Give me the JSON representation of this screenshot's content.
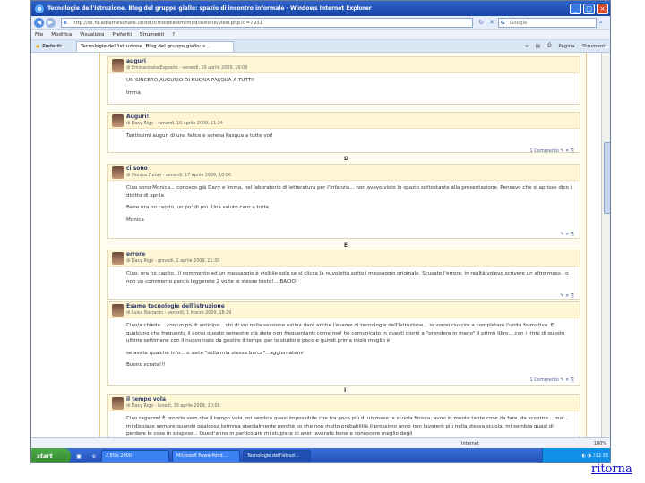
{
  "window": {
    "title": "Tecnologie dell'istruzione. Blog del gruppo giallo: spazio di incontro informale - Windows Internet Explorer",
    "address": "http://ss.f9.ad/ameschare.unisd.it/moodlestm/mod/lezione/view.php?d=7931",
    "search_placeholder": "Google"
  },
  "menu": [
    "File",
    "Modifica",
    "Visualizza",
    "Preferiti",
    "Strumenti",
    "?"
  ],
  "tabbar": {
    "favorites": "Preferiti",
    "tab_label": "Tecnologie dell'istruzione. Blog del gruppo giallo: s...",
    "page_label": "Pagina",
    "tools_label": "Strumenti"
  },
  "posts": [
    {
      "subject": "auguri",
      "author": "di Emmacolata Esposito - venerdì, 10 aprile 2009, 16:08",
      "body": [
        "UN SINCERO AUGURIO DI BUONA PASQUA A TUTTI!",
        "Imma"
      ],
      "footer": ""
    },
    {
      "subject": "Auguri!",
      "author": "di Dacy Rigo - venerdì, 10 aprile 2009, 11:24",
      "body": [
        "Tantissimi auguri di una felice e serena Pasqua a tutte voi!"
      ],
      "footer": "1 Commento"
    },
    {
      "subject": "ci sono",
      "author": "di Monica Furlan - venerdì, 17 aprile 2009, 10:06",
      "body": [
        "Ciao sono Monica... conosco già Dacy e Imma, nel laboratorio di letteratura per l'infanzia... non avevo visto lo spazio sottostante alla presentazione. Pensavo che si aprisse dico i dicitto di aprile.",
        "Bene ora ho capito, un po' di più. Una saluto caro a tutte.",
        "Monica"
      ],
      "footer": ""
    },
    {
      "subject": "errore",
      "author": "di Dacy Rigo - giovedì, 2 aprile 2009, 21:30",
      "body": [
        "Ciao, ora ho capito.. il commento ed un messaggio è visibile solo se si clicca la nuvoletta sotto i messaggio originale. Scusate l'errore, in realtà volevo scrivere un altro mess.. o non un commento perciò leggerete 2 volte le stesse testo!... BACIO!"
      ],
      "footer": ""
    },
    {
      "subject": "Esame tecnologie dell'istruzione",
      "author": "di Luisa Bastaron - venerdì, 1 marzo 2009, 18:29",
      "body": [
        "Ciao/a chiede....con un pò di anticipo... chi di voi nella sessione estiva darà anche l'esame di tecnologie dell'istruzione... io vorrei riuscire a completare l'unità formativa. E qualcuno che frequenta il corso questo semestre c'è siete non frequentanti come me! ho comunicato in questi giorni a \"prendere in mano\" il primo libro... con i ritmi di queste ultime settimane con il nuovo nato da gestire il tempo per lo studio è poco e quindi prima inizio meglio è!",
        "se avete qualche info... o siete \"sulla mia stessa barca\"...aggiornatemi",
        "Buono scrata!!!"
      ],
      "footer": "1 Commento"
    },
    {
      "subject": "il tempo vola",
      "author": "di Dacy Rigo - lunedì, 30 aprile 2009, 20:09",
      "body": [
        "Ciao ragazze! È proprio vero che il tempo vola, mi sembra quasi impossibile che tra poco più di un mese la scuola finisca, avrei in mente tante cose da fare, da scoprire... mal... mi dispiace sempre quando qualcosa termina specialmente perché so che non molto probabilità il prossimo anno non lavorerò più nella stessa scuola, mi sembra quasi di perdere le cose in sospeso... Quest'anno in particolare mi stupisce di aver lavorato bene e conoscere meglio degli"
      ],
      "footer": ""
    }
  ],
  "separators": [
    "D",
    "E",
    "I"
  ],
  "statusbar": {
    "zone": "Internet",
    "zoom": "100%"
  },
  "taskbar": {
    "start": "start",
    "tasks": [
      "2 Ellis 2000",
      "Microsoft PowerPoint...",
      "Tecnologie dell'istruzi..."
    ],
    "clock": "12.33"
  },
  "ritorna": "ritorna"
}
